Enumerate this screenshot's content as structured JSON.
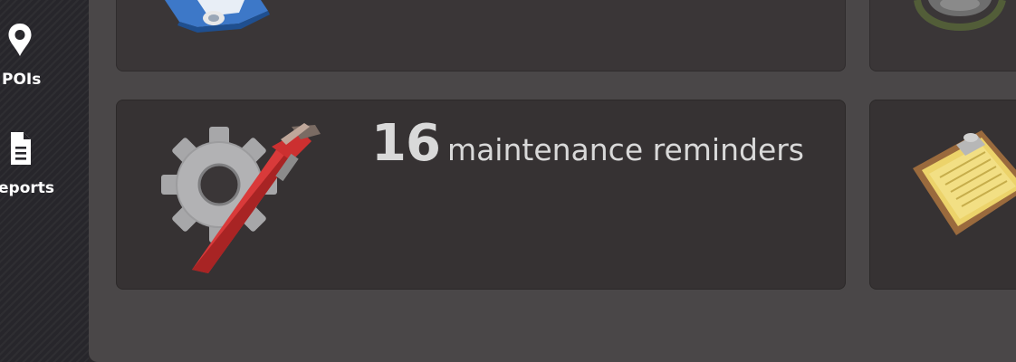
{
  "sidebar": {
    "items": [
      {
        "label": "POIs",
        "icon": "map-pin-icon"
      },
      {
        "label": "eports",
        "icon": "document-icon"
      }
    ]
  },
  "cards": {
    "maintenance": {
      "count": "16",
      "text": "maintenance reminders",
      "icon": "gear-wrench-icon"
    },
    "top_left": {
      "icon": "truck-icon"
    },
    "top_right": {
      "icon": "tire-icon"
    },
    "bottom_right": {
      "icon": "clipboard-icon"
    }
  },
  "colors": {
    "sidebar_bg": "#27262b",
    "main_bg": "#4a4748",
    "card_bg": "#3a3637",
    "text_light": "#d9d9d9",
    "wrench_red": "#d93a3a"
  }
}
